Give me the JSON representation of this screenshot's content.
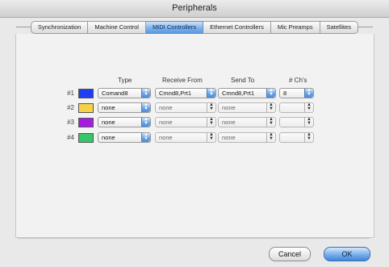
{
  "window": {
    "title": "Peripherals"
  },
  "tabs": [
    {
      "label": "Synchronization",
      "active": false
    },
    {
      "label": "Machine Control",
      "active": false
    },
    {
      "label": "MIDI Controllers",
      "active": true
    },
    {
      "label": "Ethernet Controllers",
      "active": false
    },
    {
      "label": "Mic Preamps",
      "active": false
    },
    {
      "label": "Satellites",
      "active": false
    }
  ],
  "columns": {
    "type": "Type",
    "receive_from": "Receive From",
    "send_to": "Send To",
    "channels": "# Ch's"
  },
  "rows": [
    {
      "label": "#1",
      "color": "#1f3ff0",
      "type": "Comand8",
      "receive_from": "Cmnd8,Prt1",
      "send_to": "Cmnd8,Prt1",
      "channels": "8",
      "enabled": true
    },
    {
      "label": "#2",
      "color": "#f6d247",
      "type": "none",
      "receive_from": "none",
      "send_to": "none",
      "channels": "",
      "enabled": false
    },
    {
      "label": "#3",
      "color": "#a51ee0",
      "type": "none",
      "receive_from": "none",
      "send_to": "none",
      "channels": "",
      "enabled": false
    },
    {
      "label": "#4",
      "color": "#36c667",
      "type": "none",
      "receive_from": "none",
      "send_to": "none",
      "channels": "",
      "enabled": false
    }
  ],
  "buttons": {
    "cancel": "Cancel",
    "ok": "OK"
  },
  "icons": {
    "popup_arrows": "updown-arrows-icon"
  }
}
